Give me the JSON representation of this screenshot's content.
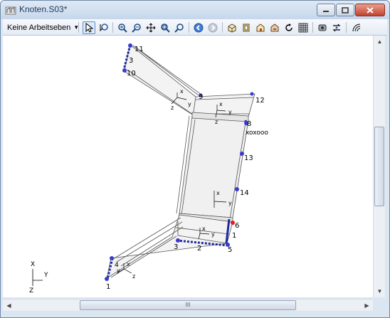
{
  "window": {
    "title": "Knoten.S03*"
  },
  "toolbar": {
    "workplane_dropdown": "Keine Arbeitseben",
    "icons": [
      "select-arrow-icon",
      "select-zoom-icon",
      "zoom-in-icon",
      "zoom-out-icon",
      "pan-icon",
      "zoom-window-icon",
      "zoom-all-icon",
      "back-icon",
      "forward-icon",
      "iso-view-icon",
      "front-view-icon",
      "side-view-icon",
      "top-view-icon",
      "rotate-icon",
      "grid-icon",
      "render-icon",
      "swap-icon",
      "arc-icon"
    ]
  },
  "viewport": {
    "node_labels": [
      "1",
      "2",
      "3",
      "4",
      "5",
      "6",
      "8",
      "9",
      "10",
      "11",
      "12",
      "13",
      "14"
    ],
    "extra_label": "xoxooo",
    "axis_labels": {
      "x": "x",
      "y": "y",
      "z": "z"
    },
    "triad": {
      "x": "X",
      "y": "Y",
      "z": "Z"
    }
  },
  "scrollbar": {
    "grip": "III"
  },
  "colors": {
    "structure": "#555555",
    "node": "#3a3ad0",
    "support": "#1d2a9a",
    "selected": "#e02020"
  }
}
